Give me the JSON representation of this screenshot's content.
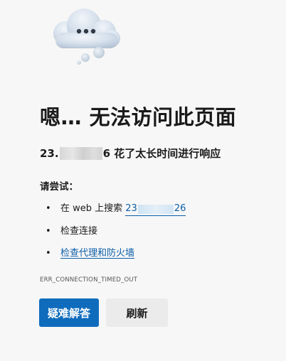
{
  "error_page": {
    "title": "嗯… 无法访问此页面",
    "subtitle_prefix": "23.",
    "subtitle_suffix": "6 花了太长时间进行响应",
    "try_heading": "请尝试：",
    "suggestions": [
      {
        "text_prefix": "在 web 上搜索 ",
        "link_prefix": "23",
        "link_suffix": "26"
      },
      {
        "text": "检查连接"
      },
      {
        "text": "检查代理和防火墙"
      }
    ],
    "error_code": "ERR_CONNECTION_TIMED_OUT",
    "buttons": {
      "troubleshoot_label": "疑难解答",
      "refresh_label": "刷新"
    }
  },
  "colors": {
    "background": "#f7f7f7",
    "link": "#0b5ea8",
    "primary_button": "#0f6cbd",
    "secondary_button": "#ebebeb"
  },
  "icons": {
    "illustration": "cloud-with-dots-icon",
    "bullet": "bullet-dot"
  }
}
